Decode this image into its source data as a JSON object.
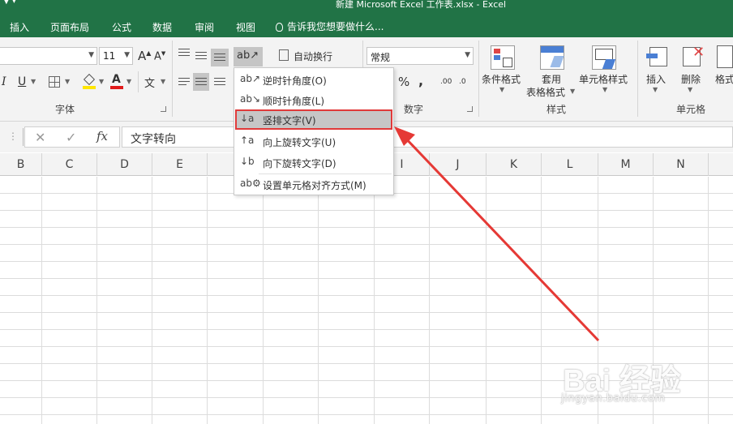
{
  "window": {
    "qat_symbol": "▼ ▾",
    "title": "新建 Microsoft Excel 工作表.xlsx - Excel"
  },
  "tabs": [
    "插入",
    "页面布局",
    "公式",
    "数据",
    "审阅",
    "视图"
  ],
  "tell_me": "告诉我您想要做什么...",
  "ribbon": {
    "font_size": "11",
    "font_grow": "A",
    "font_shrink": "A",
    "italic": "I",
    "underline": "U",
    "font_color_letter": "A",
    "wrap_text": "自动换行",
    "number_format": "常规",
    "percent": "%",
    "comma": ",",
    "inc_decimal": ".00",
    "dec_decimal": ".0",
    "conditional_format": "条件格式",
    "table_format_line1": "套用",
    "table_format_line2": "表格格式",
    "cell_styles": "单元格样式",
    "insert": "插入",
    "delete": "删除",
    "format": "格式",
    "groups": {
      "font": "字体",
      "number": "数字",
      "styles": "样式",
      "cells": "单元格"
    },
    "colors": {
      "highlight": "#ffe600",
      "font_color": "#e01a1a"
    }
  },
  "formula_bar": {
    "cancel": "✕",
    "enter": "✓",
    "fx": "fx",
    "content": "文字转向"
  },
  "columns": [
    "B",
    "C",
    "D",
    "E",
    "",
    "I",
    "J",
    "K",
    "L",
    "M",
    "N"
  ],
  "orientation_menu": {
    "items": [
      {
        "label": "逆时针角度(O)",
        "icon": "rotate-ccw-text-icon"
      },
      {
        "label": "顺时针角度(L)",
        "icon": "rotate-cw-text-icon"
      },
      {
        "label": "竖排文字(V)",
        "icon": "vertical-text-icon"
      },
      {
        "label": "向上旋转文字(U)",
        "icon": "rotate-up-text-icon"
      },
      {
        "label": "向下旋转文字(D)",
        "icon": "rotate-down-text-icon"
      },
      {
        "label": "设置单元格对齐方式(M)",
        "icon": "format-alignment-icon"
      }
    ],
    "highlighted": "竖排文字(V)"
  },
  "annotation": {
    "arrow_color": "#e53935"
  },
  "watermark": {
    "logo": "Bai 经验",
    "url": "jingyan.baidu.com"
  }
}
